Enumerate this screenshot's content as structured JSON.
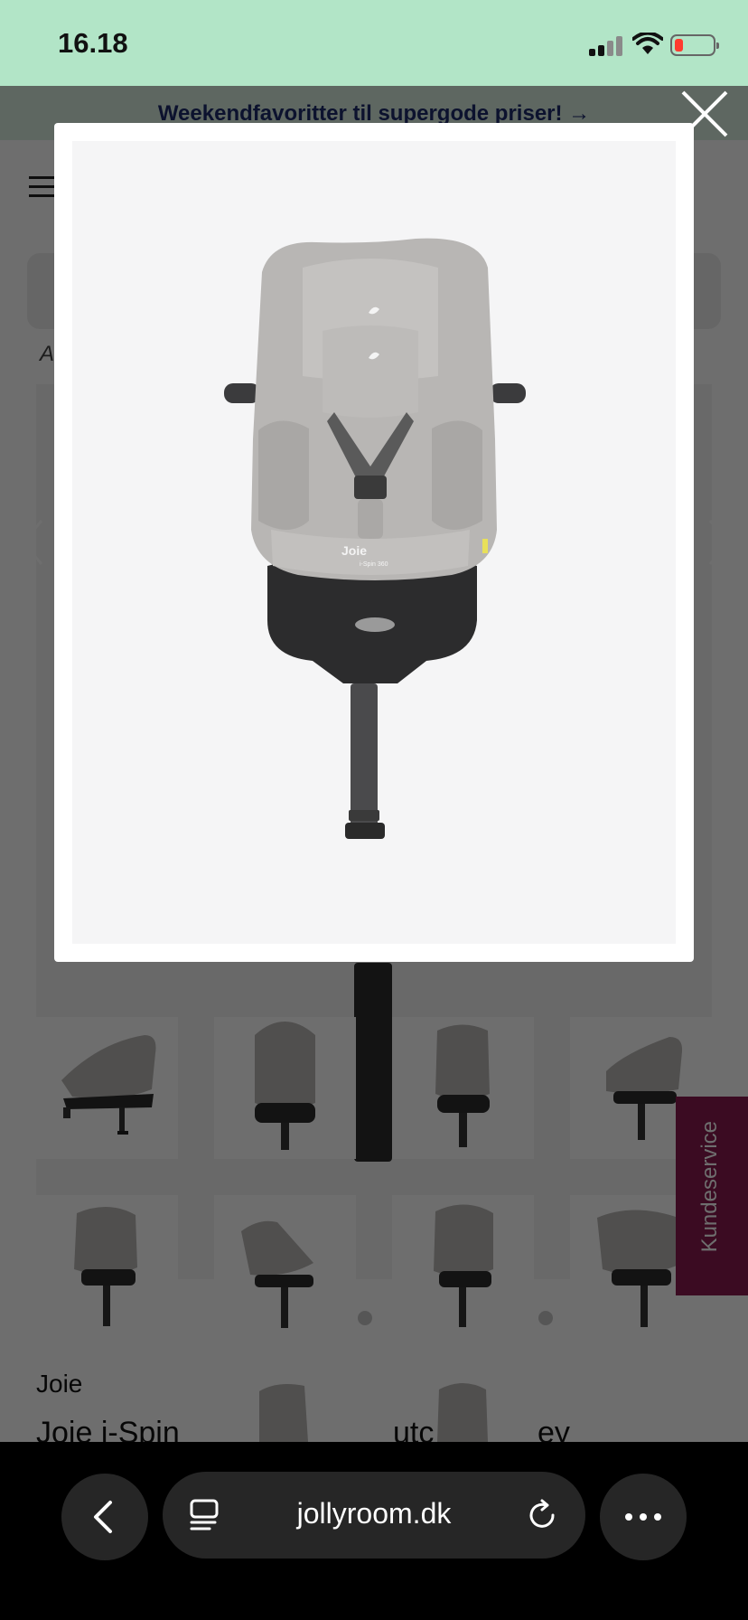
{
  "status_bar": {
    "time": "16.18",
    "battery_color": "#ff3b30"
  },
  "promo": {
    "text": "Weekendfavoritter til supergode priser! →"
  },
  "breadcrumb": {
    "text": "A"
  },
  "product": {
    "brand": "Joie",
    "title_fragment_1": "Joie i-Spin",
    "title_fragment_2": "utc",
    "title_fragment_3": "ey"
  },
  "side_tab": {
    "label": "Kundeservice",
    "color": "#8a1b4f"
  },
  "lightbox": {
    "image_alt": "Joie i-Spin 360 car seat, grey, front view",
    "seat_brand_label": "Joie",
    "seat_model_label": "i-Spin 360",
    "close_icon": "close-icon"
  },
  "thumbnails": [
    {
      "view": "side-reclined"
    },
    {
      "view": "front-top"
    },
    {
      "view": "front"
    },
    {
      "view": "side"
    },
    {
      "view": "three-quarter-left"
    },
    {
      "view": "side-rear"
    },
    {
      "view": "front-three-quarter"
    },
    {
      "view": "three-quarter-right"
    },
    {
      "view": "side-top"
    },
    {
      "view": "front-top-2"
    }
  ],
  "browser": {
    "url": "jollyroom.dk",
    "back_icon": "chevron-left-icon",
    "tabs_icon": "reader-icon",
    "reload_icon": "reload-icon",
    "more_icon": "ellipsis-icon"
  },
  "colors": {
    "status_bar_bg": "#b2e5c7",
    "promo_text": "#1c2a6b",
    "seat_grey": "#b8b6b4"
  }
}
